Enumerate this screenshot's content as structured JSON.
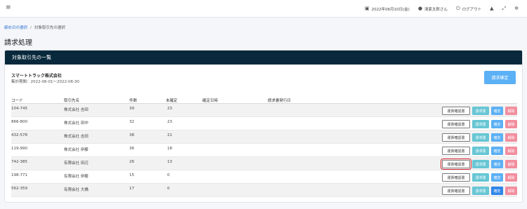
{
  "topbar": {
    "menu_icon": "hamburger-icon",
    "date": "2022年06月10日(金)",
    "user": "清家太郎さん",
    "logout": "ログアウト",
    "icons": [
      "calendar-icon",
      "user-icon",
      "power-icon",
      "bell-icon",
      "expand-icon",
      "settings-icon"
    ]
  },
  "breadcrumb": {
    "link": "締め日の選択",
    "separator": "/",
    "current": "対象取引先の選択"
  },
  "page": {
    "title": "請求処理"
  },
  "card": {
    "header": "対象取引先の一覧",
    "company": "スマートトラック株式会社",
    "period": "集計期間：2022-06-01〜2022-06-30",
    "confirm_all": "請求確定"
  },
  "table": {
    "headers": {
      "code": "コード",
      "name": "取引先名",
      "count": "件数",
      "unconfirmed": "未確定",
      "confirmed_at": "確定日時",
      "issued_at": "請求書発行日"
    },
    "rows": [
      {
        "code": "104-745",
        "name": "株式会社 吉田",
        "count": "39",
        "unconfirmed": "23",
        "confirmed_at": "",
        "issued_at": ""
      },
      {
        "code": "866-800",
        "name": "株式会社 田中",
        "count": "32",
        "unconfirmed": "23",
        "confirmed_at": "",
        "issued_at": ""
      },
      {
        "code": "432-578",
        "name": "株式会社 吉田",
        "count": "38",
        "unconfirmed": "21",
        "confirmed_at": "",
        "issued_at": ""
      },
      {
        "code": "119-990",
        "name": "株式会社 伊藤",
        "count": "36",
        "unconfirmed": "18",
        "confirmed_at": "",
        "issued_at": ""
      },
      {
        "code": "742-385",
        "name": "有限会社 田辺",
        "count": "26",
        "unconfirmed": "13",
        "confirmed_at": "",
        "issued_at": ""
      },
      {
        "code": "198-771",
        "name": "有限会社 伊藤",
        "count": "15",
        "unconfirmed": "0",
        "confirmed_at": "",
        "issued_at": ""
      },
      {
        "code": "562-359",
        "name": "有限会社 大橋",
        "count": "17",
        "unconfirmed": "0",
        "confirmed_at": "",
        "issued_at": ""
      }
    ],
    "actions": {
      "shipping": "運賃確認書",
      "invoice": "請求書",
      "confirm": "確定",
      "cancel": "解除"
    }
  },
  "colors": {
    "header_bg": "#08293c",
    "confirm_btn": "#5cb0f5",
    "invoice_btn": "#67c6d4",
    "cancel_btn": "#f28e9e",
    "highlight": "#d9262e"
  }
}
